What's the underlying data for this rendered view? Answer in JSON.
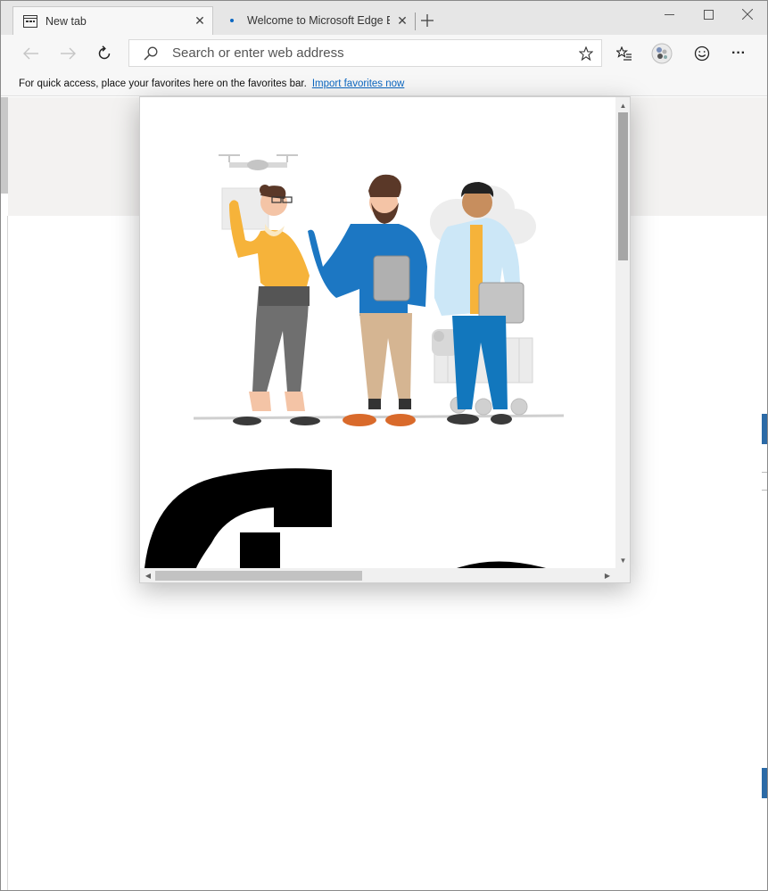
{
  "browser": {
    "tabs": [
      {
        "label": "New tab",
        "active": true,
        "icon": "new-tab-page-icon"
      },
      {
        "label": "Welcome to Microsoft Edge Beta",
        "active": false,
        "icon": "loading-dot-icon"
      }
    ],
    "tab_close_glyph": "✕",
    "new_tab_glyph": "+",
    "window_controls": {
      "minimize": "—",
      "maximize": "☐",
      "close": "✕"
    }
  },
  "toolbar": {
    "back_icon": "back-arrow-icon",
    "forward_icon": "forward-arrow-icon",
    "refresh_icon": "refresh-icon",
    "address": {
      "placeholder": "Search or enter web address",
      "value": ""
    },
    "favorite_star_icon": "star-icon",
    "favorites_icon": "favorites-list-icon",
    "profile_icon": "profile-avatar-icon",
    "feedback_icon": "smiley-icon",
    "more_glyph": "···"
  },
  "favorites_bar": {
    "message": "For quick access, place your favorites here on the favorites bar.",
    "import_link": "Import favorites now"
  },
  "popup": {
    "illustration": "people-with-devices-illustration",
    "partial_glyphs": "large-black-letterform"
  },
  "colors": {
    "accent_purple": "#5b0e72",
    "link_blue": "#0b67c2",
    "edge_blue": "#2b6aa6",
    "person_yellow": "#f6b33a",
    "person_blue": "#1c77c3"
  }
}
